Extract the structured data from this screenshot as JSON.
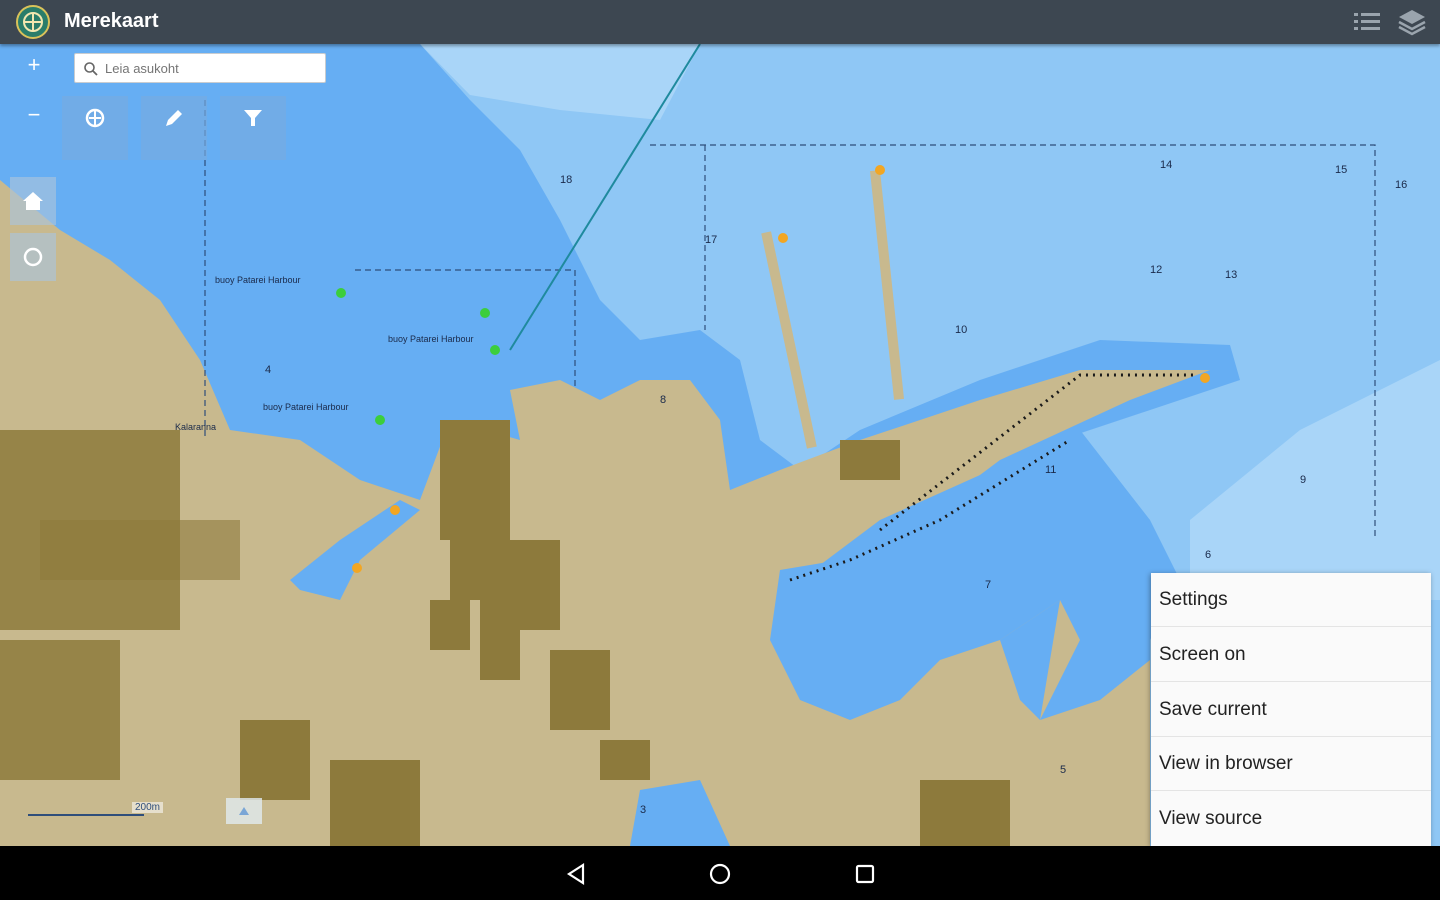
{
  "app": {
    "title": "Merekaart",
    "logo_icon": "maritime-administration-logo"
  },
  "appbar_actions": [
    {
      "name": "list-icon"
    },
    {
      "name": "layers-icon"
    }
  ],
  "search": {
    "placeholder": "Leia asukoht",
    "value": ""
  },
  "zoom": {
    "in_label": "+",
    "out_label": "−"
  },
  "toolbar": [
    {
      "name": "measure-icon"
    },
    {
      "name": "pencil-icon"
    },
    {
      "name": "filter-icon"
    }
  ],
  "side_buttons": [
    {
      "name": "home-icon"
    },
    {
      "name": "locate-icon"
    }
  ],
  "scale": {
    "label": "200m"
  },
  "menu": {
    "items": [
      {
        "label": "Settings"
      },
      {
        "label": "Screen on"
      },
      {
        "label": "Save current"
      },
      {
        "label": "View in browser"
      },
      {
        "label": "View source"
      }
    ]
  },
  "colors": {
    "land": "#c8b98e",
    "shallow": "#66aef3",
    "deep": "#8fc7f5",
    "appbar": "#3d4751"
  },
  "map_labels": {
    "buoy1": "buoy Patarei Harbour",
    "buoy2": "buoy Patarei Harbour",
    "buoy3": "buoy Patarei Harbour",
    "kalaranna": "Kalaranna",
    "depths": [
      "12",
      "13",
      "14",
      "15",
      "16",
      "10",
      "11",
      "17",
      "18",
      "9",
      "8",
      "7",
      "6",
      "5",
      "4",
      "3"
    ]
  }
}
